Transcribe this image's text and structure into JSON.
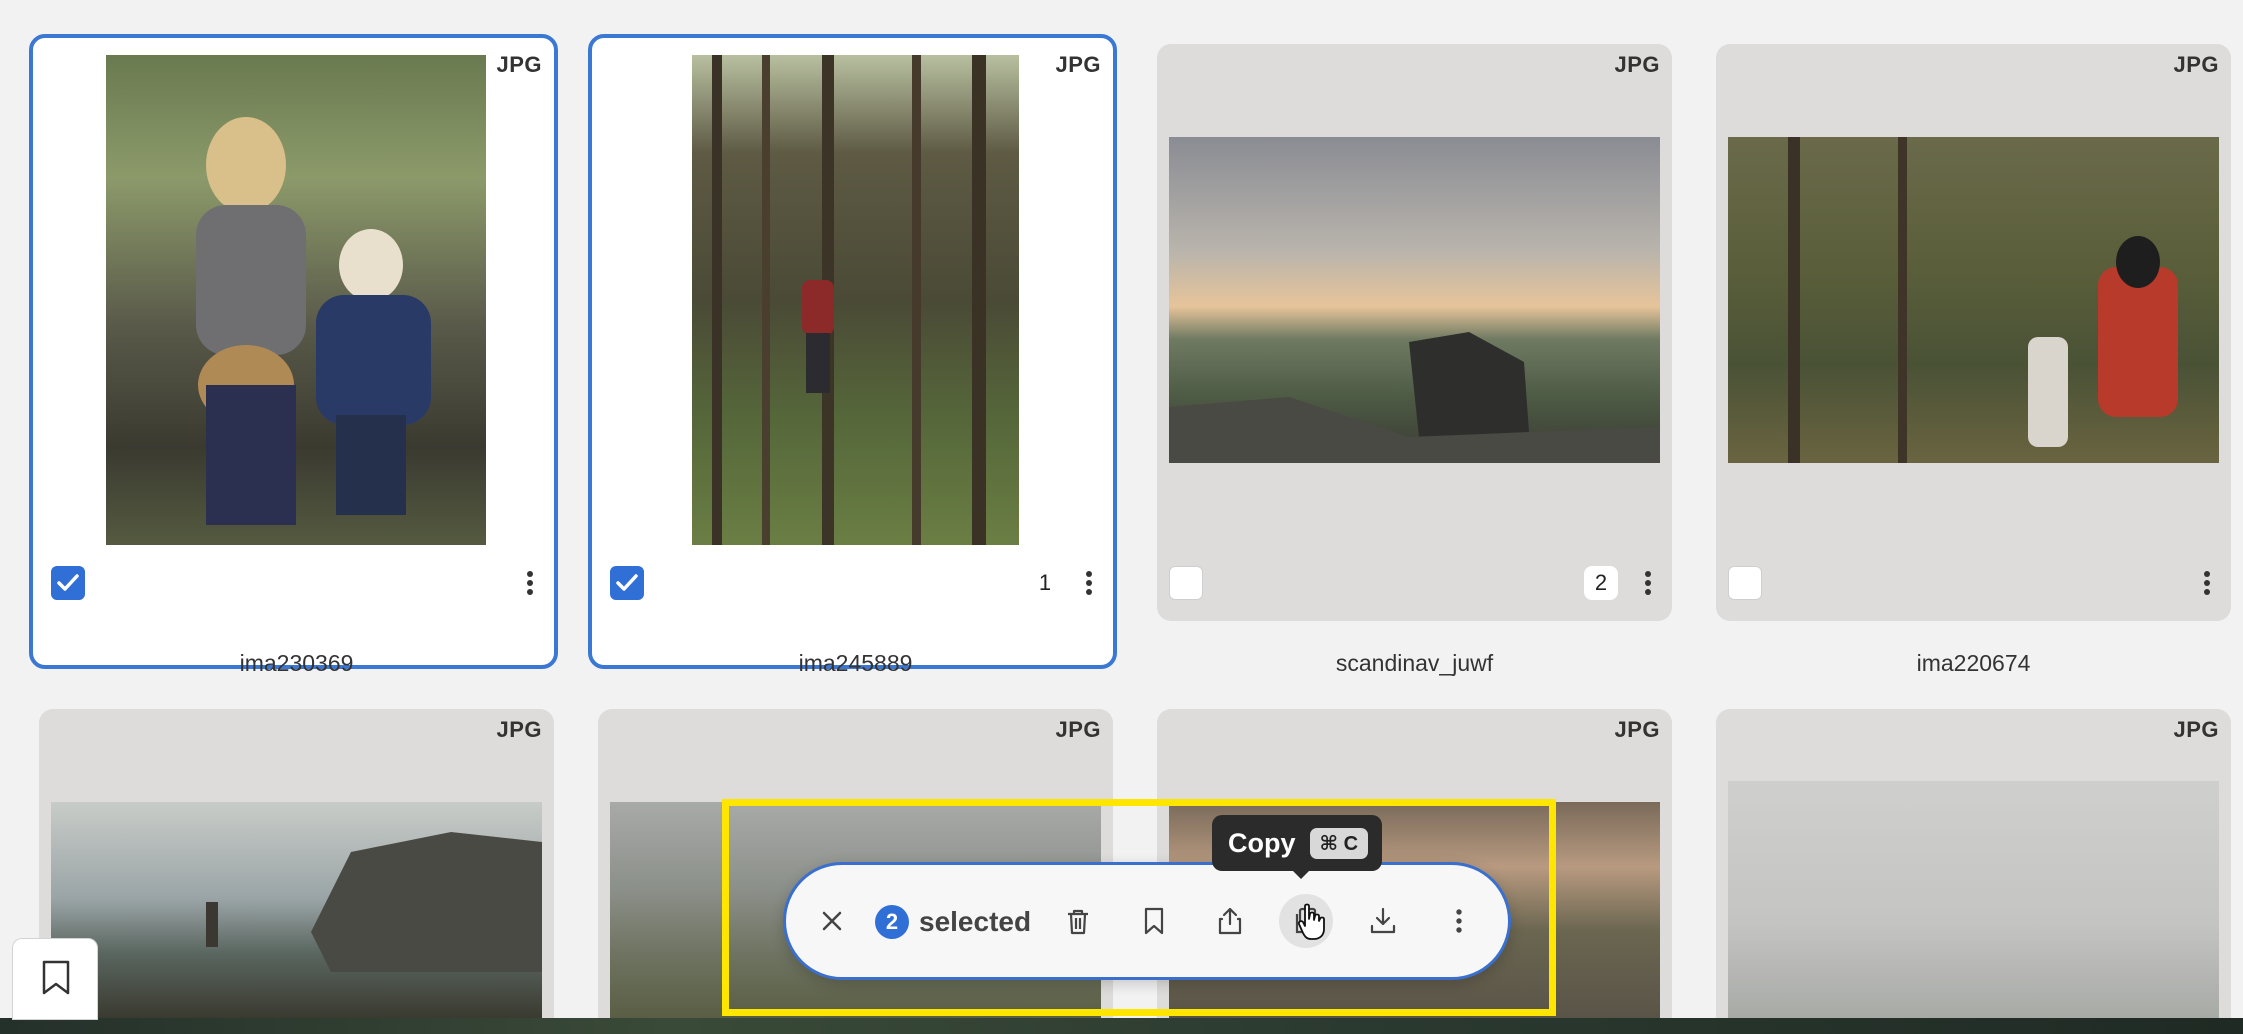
{
  "cards": [
    {
      "name": "ima230369",
      "badge": "JPG",
      "selected": true,
      "count": ""
    },
    {
      "name": "ima245889",
      "badge": "JPG",
      "selected": true,
      "count": "1"
    },
    {
      "name": "scandinav_juwf",
      "badge": "JPG",
      "selected": false,
      "count": "2"
    },
    {
      "name": "ima220674",
      "badge": "JPG",
      "selected": false,
      "count": ""
    },
    {
      "name": "",
      "badge": "JPG",
      "selected": false,
      "count": ""
    },
    {
      "name": "",
      "badge": "JPG",
      "selected": false,
      "count": ""
    },
    {
      "name": "",
      "badge": "JPG",
      "selected": false,
      "count": ""
    },
    {
      "name": "",
      "badge": "JPG",
      "selected": false,
      "count": ""
    }
  ],
  "selection_bar": {
    "count": "2",
    "label": "selected",
    "icons": [
      "close-icon",
      "trash-icon",
      "bookmark-icon",
      "share-icon",
      "copy-icon",
      "download-icon",
      "more-icon"
    ]
  },
  "tooltip": {
    "label": "Copy",
    "shortcut": "⌘ C"
  },
  "colors": {
    "accent": "#2f6fd6",
    "highlight": "#ffe600",
    "tile": "#dedcda"
  }
}
